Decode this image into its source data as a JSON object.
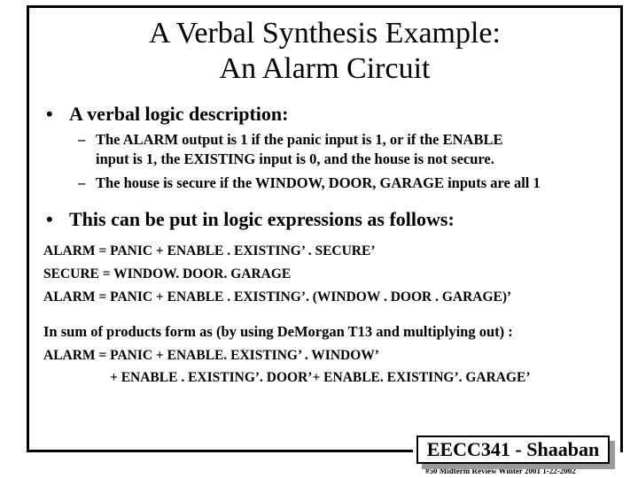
{
  "slide": {
    "title_lines": [
      "A Verbal Synthesis Example:",
      "An Alarm Circuit"
    ],
    "bullets": [
      {
        "marker": "•",
        "text": "A verbal logic description:",
        "subitems": [
          {
            "marker": "–",
            "lines": [
              "The ALARM output is  1  if the panic input is 1,   or if the ENABLE",
              "input is  1, the EXISTING input is 0, and the house is not secure."
            ]
          },
          {
            "marker": "–",
            "lines": [
              "The house is secure if the WINDOW, DOOR, GARAGE inputs are all 1"
            ]
          }
        ]
      },
      {
        "marker": "•",
        "text": "This can be put in logic expressions as follows:"
      }
    ],
    "expressions": [
      "ALARM  =  PANIC +  ENABLE . EXISTING’ . SECURE’",
      "SECURE =  WINDOW. DOOR. GARAGE",
      "ALARM =  PANIC + ENABLE . EXISTING’. (WINDOW . DOOR . GARAGE)’"
    ],
    "sop_heading": "In sum of products form as (by using DeMorgan T13 and multiplying out) :",
    "sop_lines": [
      "ALARM = PANIC +  ENABLE. EXISTING’ . WINDOW’",
      "+ ENABLE . EXISTING’. DOOR’+  ENABLE. EXISTING’. GARAGE’"
    ]
  },
  "footer": {
    "course": "EECC341 - Shaaban",
    "note": "#50   Midterm Review   Winter 2001  1-22-2002"
  }
}
